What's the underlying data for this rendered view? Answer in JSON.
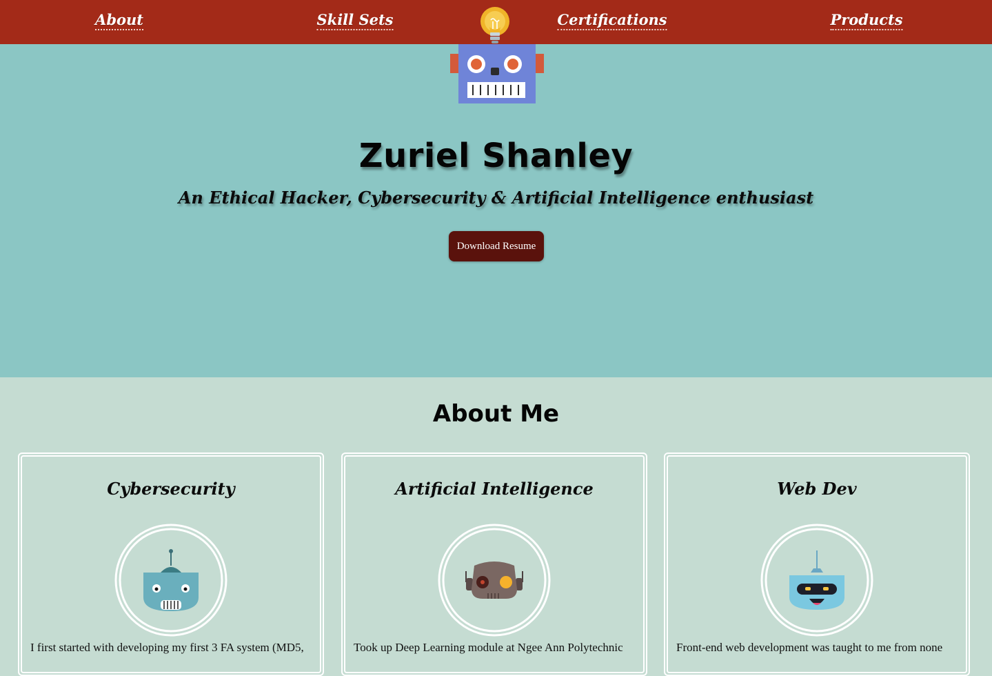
{
  "nav": {
    "items": [
      {
        "label": "About"
      },
      {
        "label": "Skill Sets"
      },
      {
        "label": "Certifications"
      },
      {
        "label": "Products"
      }
    ]
  },
  "hero": {
    "name": "Zuriel Shanley",
    "tagline": "An Ethical Hacker, Cybersecurity & Artificial Intelligence enthusiast",
    "resume_button": "Download Resume"
  },
  "about": {
    "title": "About Me",
    "cards": [
      {
        "title": "Cybersecurity",
        "icon": "teal-robot-icon",
        "text": "I first started with developing my first 3 FA system (MD5,"
      },
      {
        "title": "Artificial Intelligence",
        "icon": "brown-robot-icon",
        "text": "Took up Deep Learning module at Ngee Ann Polytechnic"
      },
      {
        "title": "Web Dev",
        "icon": "blue-robot-icon",
        "text": "Front-end web development was taught to me from none"
      }
    ]
  },
  "colors": {
    "navbar": "#a32a18",
    "hero_bg": "#8bc6c4",
    "section_bg": "#c5dcd2",
    "button": "#5a120c"
  }
}
